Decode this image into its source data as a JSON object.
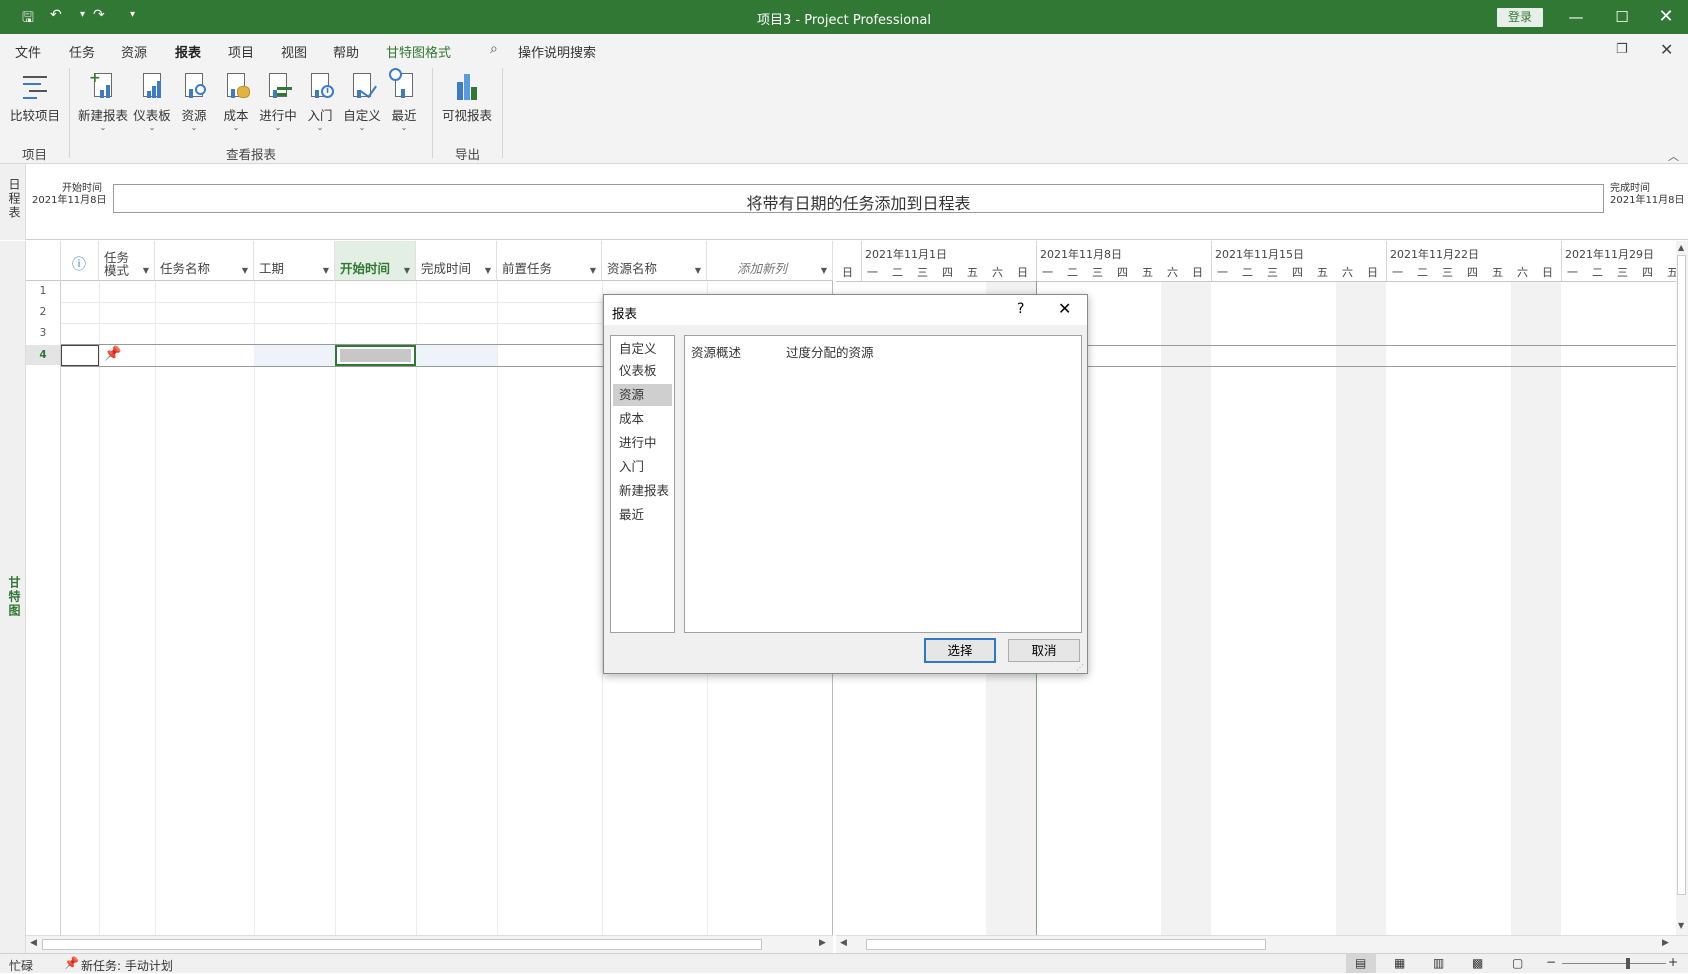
{
  "window": {
    "title": "项目3  -  Project Professional",
    "login_label": "登录",
    "colors": {
      "accent": "#317835",
      "dialog_focus": "#2f78c4"
    }
  },
  "menu": {
    "tabs": [
      {
        "label": "文件",
        "active": false
      },
      {
        "label": "任务",
        "active": false
      },
      {
        "label": "资源",
        "active": false
      },
      {
        "label": "报表",
        "active": true
      },
      {
        "label": "项目",
        "active": false
      },
      {
        "label": "视图",
        "active": false
      },
      {
        "label": "帮助",
        "active": false
      },
      {
        "label": "甘特图格式",
        "active": false,
        "contextual": true
      }
    ],
    "search_label": "操作说明搜索"
  },
  "ribbon": {
    "groups": [
      {
        "label": "项目",
        "buttons": [
          {
            "label": "比较项目",
            "icon": "compare-projects-icon",
            "dropdown": false
          }
        ]
      },
      {
        "label": "查看报表",
        "buttons": [
          {
            "label": "新建报表",
            "icon": "new-report-icon",
            "dropdown": true
          },
          {
            "label": "仪表板",
            "icon": "dashboard-icon",
            "dropdown": true
          },
          {
            "label": "资源",
            "icon": "resources-report-icon",
            "dropdown": true
          },
          {
            "label": "成本",
            "icon": "costs-report-icon",
            "dropdown": true
          },
          {
            "label": "进行中",
            "icon": "in-progress-report-icon",
            "dropdown": true
          },
          {
            "label": "入门",
            "icon": "getting-started-icon",
            "dropdown": true
          },
          {
            "label": "自定义",
            "icon": "custom-report-icon",
            "dropdown": true
          },
          {
            "label": "最近",
            "icon": "recent-report-icon",
            "dropdown": true
          }
        ]
      },
      {
        "label": "导出",
        "buttons": [
          {
            "label": "可视报表",
            "icon": "visual-reports-icon",
            "dropdown": false
          }
        ]
      }
    ]
  },
  "timeline": {
    "side_label": "日程表",
    "start_label": "开始时间",
    "start_date": "2021年11月8日",
    "placeholder": "将带有日期的任务添加到日程表",
    "end_label": "完成时间",
    "end_date": "2021年11月8日"
  },
  "gantt": {
    "side_label": "甘特图",
    "columns": [
      {
        "label": "ⓘ",
        "dropdown": false
      },
      {
        "label": "任务\n模式",
        "dropdown": true
      },
      {
        "label": "任务名称",
        "dropdown": true
      },
      {
        "label": "工期",
        "dropdown": true
      },
      {
        "label": "开始时间",
        "dropdown": true,
        "selected": true
      },
      {
        "label": "完成时间",
        "dropdown": true
      },
      {
        "label": "前置任务",
        "dropdown": true
      },
      {
        "label": "资源名称",
        "dropdown": true
      },
      {
        "label": "添加新列",
        "dropdown": true,
        "italic": true
      }
    ],
    "rows": [
      "1",
      "2",
      "3",
      "4"
    ],
    "selected_row": "4",
    "weeks": [
      "2021年11月1日",
      "2021年11月8日",
      "2021年11月15日",
      "2021年11月22日",
      "2021年11月29日"
    ],
    "days": [
      "日",
      "一",
      "二",
      "三",
      "四",
      "五",
      "六"
    ]
  },
  "dialog": {
    "title": "报表",
    "help": "?",
    "categories": [
      "自定义",
      "仪表板",
      "资源",
      "成本",
      "进行中",
      "入门",
      "新建报表",
      "最近"
    ],
    "selected_category": "资源",
    "options": [
      "资源概述",
      "过度分配的资源"
    ],
    "select_label": "选择",
    "cancel_label": "取消"
  },
  "status": {
    "mode": "忙碌",
    "new_task": "新任务: 手动计划"
  }
}
